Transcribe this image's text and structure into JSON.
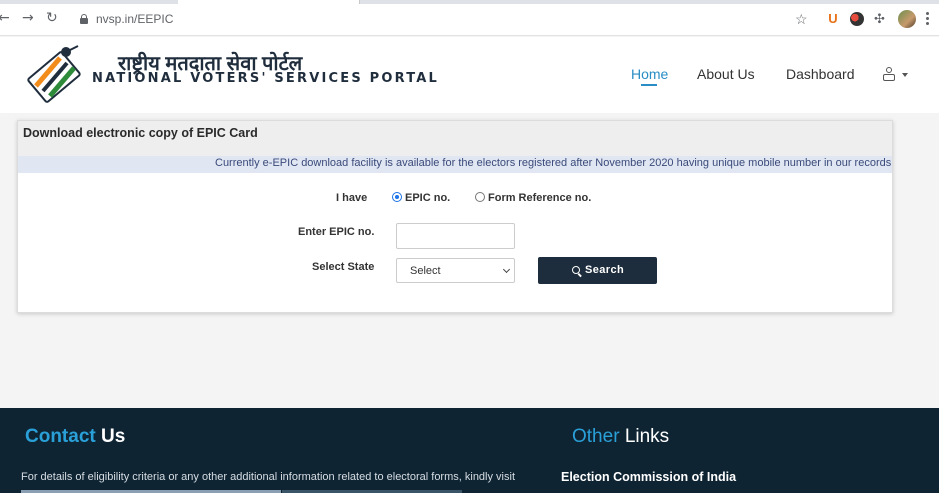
{
  "browser": {
    "url": "nvsp.in/EEPIC",
    "back_icon": "arrow-left-icon",
    "forward_icon": "arrow-right-icon",
    "reload_icon": "reload-icon",
    "extension_u_label": "U"
  },
  "header": {
    "logo_hindi": "राष्ट्रीय मतदाता सेवा पोर्टल",
    "logo_english": "NATIONAL VOTERS' SERVICES PORTAL",
    "nav": {
      "home": "Home",
      "about": "About Us",
      "dashboard": "Dashboard"
    }
  },
  "card": {
    "title": "Download electronic copy of EPIC Card",
    "notice": "Currently e-EPIC download facility is available for the electors registered after November 2020 having unique mobile number in our records. For",
    "have_label": "I have",
    "options": {
      "epic": "EPIC no.",
      "form_ref": "Form Reference no.",
      "selected": "epic"
    },
    "epic_label": "Enter EPIC no.",
    "epic_value": "",
    "state_label": "Select State",
    "state_selected": "Select",
    "search_label": "Search"
  },
  "footer": {
    "contact_accent": "Contact",
    "contact_rest": "Us",
    "other_accent": "Other",
    "other_rest": "Links",
    "contact_text": "For details of eligibility criteria or any other additional information related to electoral forms, kindly visit",
    "link_eci": "Election Commission of India"
  },
  "colors": {
    "accent": "#2a8dc4",
    "footer_bg": "#0f2433",
    "button_bg": "#1e2d3d"
  }
}
